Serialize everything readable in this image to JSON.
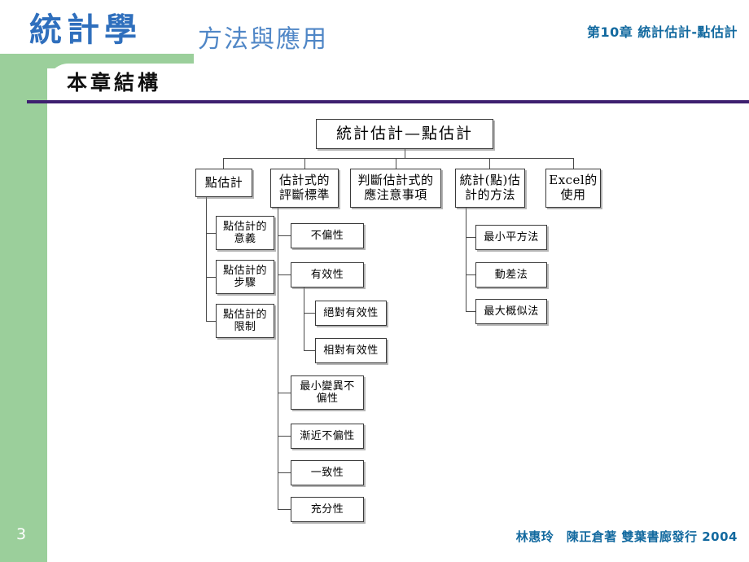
{
  "slide": {
    "brand_title": "統計學",
    "brand_subtitle": "方法與應用",
    "chapter_label": "第10章 統計估計-點估計",
    "section_title": "本章結構",
    "page_number": "3",
    "credit": "林惠玲　陳正倉著 雙葉書廊發行  2004",
    "colors": {
      "green_panel": "#9bcf9b",
      "brand_blue": "#2f6fbd",
      "subtitle_blue": "#4f86c6",
      "chapter_blue": "#12699f",
      "rule_purple": "#3e2070",
      "node_border": "#3a3a3a"
    }
  },
  "chart_data": {
    "type": "diagram",
    "title": "統計估計—點估計",
    "root": {
      "label": "統計估計—點估計"
    },
    "level2": [
      {
        "label": "點估計"
      },
      {
        "label": "估計式的\n評斷標準",
        "line1": "估計式的",
        "line2": "評斷標準"
      },
      {
        "label": "判斷估計式的\n應注意事項",
        "line1": "判斷估計式的",
        "line2": "應注意事項"
      },
      {
        "label": "統計(點)估\n計的方法",
        "line1": "統計(點)估",
        "line2": "計的方法"
      },
      {
        "label": "Excel的\n使用",
        "line1": "Excel的",
        "line2": "使用"
      }
    ],
    "branch_point_estimate": [
      {
        "line1": "點估計的",
        "line2": "意義"
      },
      {
        "line1": "點估計的",
        "line2": "步驟"
      },
      {
        "line1": "點估計的",
        "line2": "限制"
      }
    ],
    "branch_criteria": [
      {
        "line1": "不偏性",
        "line2": ""
      },
      {
        "line1": "有效性",
        "line2": ""
      },
      {
        "line1": "最小變異不",
        "line2": "偏性"
      },
      {
        "line1": "漸近不偏性",
        "line2": ""
      },
      {
        "line1": "一致性",
        "line2": ""
      },
      {
        "line1": "充分性",
        "line2": ""
      }
    ],
    "branch_effectiveness": [
      {
        "line1": "絕對有效性",
        "line2": ""
      },
      {
        "line1": "相對有效性",
        "line2": ""
      }
    ],
    "branch_methods": [
      {
        "line1": "最小平方法",
        "line2": ""
      },
      {
        "line1": "動差法",
        "line2": ""
      },
      {
        "line1": "最大概似法",
        "line2": ""
      }
    ]
  }
}
